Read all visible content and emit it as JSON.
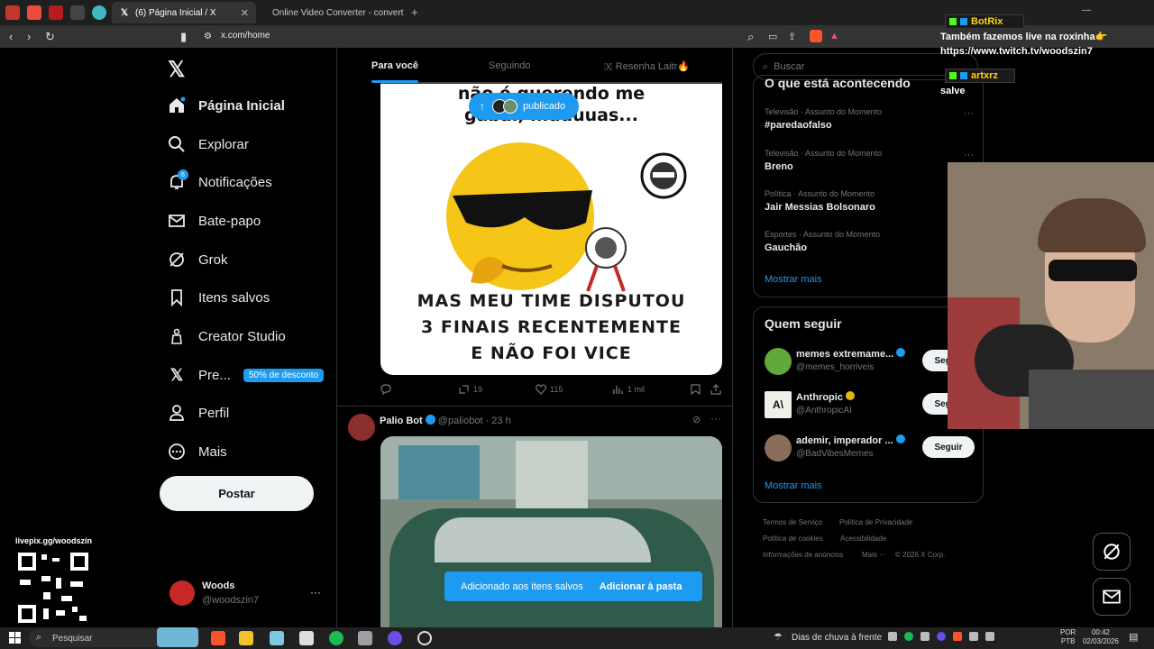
{
  "browser": {
    "tabs": [
      {
        "title": "(6) Página Inicial / X",
        "favicon": "x-logo",
        "active": true
      },
      {
        "title": "Online Video Converter - converta vi",
        "favicon": "converter-icon",
        "active": false
      }
    ],
    "new_tab": "+",
    "url": "x.com/home"
  },
  "nav": {
    "items": [
      {
        "label": "Página Inicial",
        "icon": "home-icon"
      },
      {
        "label": "Explorar",
        "icon": "search-icon"
      },
      {
        "label": "Notificações",
        "icon": "bell-icon",
        "badge": "6"
      },
      {
        "label": "Bate-papo",
        "icon": "mail-icon"
      },
      {
        "label": "Grok",
        "icon": "grok-icon"
      },
      {
        "label": "Itens salvos",
        "icon": "bookmark-icon"
      },
      {
        "label": "Creator Studio",
        "icon": "creator-icon"
      },
      {
        "label": "Pre...",
        "icon": "x-logo-icon",
        "badge": "50% de desconto"
      },
      {
        "label": "Perfil",
        "icon": "person-icon"
      },
      {
        "label": "Mais",
        "icon": "more-circle-icon"
      }
    ],
    "post_label": "Postar",
    "account": {
      "name": "Woods",
      "handle": "@woodszin7",
      "more": "···"
    }
  },
  "timeline": {
    "tabs": [
      "Para você",
      "Seguindo",
      "🇽 Resenha Laitr🔥"
    ],
    "new_posts_pill": "publicado",
    "meme": {
      "top_text_1": "não é querendo me",
      "top_text_2": "gabar, muuuuas...",
      "bottom_lines": [
        "MAS MEU TIME DISPUTOU",
        "3 FINAIS RECENTEMENTE",
        "E NÃO FOI VICE"
      ]
    },
    "post1_actions": {
      "reply": "",
      "retweets": "19",
      "likes": "115",
      "views": "1 mil"
    },
    "post2": {
      "name": "Palio Bot",
      "handle": "@paliobot",
      "time": "· 23 h"
    },
    "toast": {
      "text": "Adicionado aos itens salvos",
      "action": "Adicionar à pasta"
    }
  },
  "sidebar": {
    "search_placeholder": "Buscar",
    "trends_title": "O que está acontecendo",
    "trends": [
      {
        "category": "Televisão · Assunto do Momento",
        "name": "#paredaofalso"
      },
      {
        "category": "Televisão · Assunto do Momento",
        "name": "Breno"
      },
      {
        "category": "Política · Assunto do Momento",
        "name": "Jair Messias Bolsonaro"
      },
      {
        "category": "Esportes · Assunto do Momento",
        "name": "Gauchão"
      }
    ],
    "show_more": "Mostrar mais",
    "who_to_follow_title": "Quem seguir",
    "who_to_follow": [
      {
        "name": "memes extremame...",
        "handle": "@memes_horriveis",
        "button": "Seguir"
      },
      {
        "name": "Anthropic",
        "handle": "@AnthropicAI",
        "button": "Seguir"
      },
      {
        "name": "ademir, imperador ...",
        "handle": "@BadVibesMemes",
        "button": "Seguir"
      }
    ],
    "show_more_2": "Mostrar mais",
    "footer": [
      "Termos de Serviço",
      "Política de Privacidade",
      "Política de cookies",
      "Acessibilidade",
      "Informações de anúncios",
      "Mais ···",
      "© 2026 X Corp."
    ]
  },
  "overlay": {
    "chat": [
      {
        "user": "BotRix",
        "message": "Também fazemos live na roxinha👉 https://www.twitch.tv/woodszin7"
      },
      {
        "user": "artxrz",
        "message": "salve"
      }
    ],
    "livepix": "livepix.gg/woodszin"
  },
  "taskbar": {
    "search": "Pesquisar",
    "weather": "Dias de chuva à frente",
    "lang_1": "POR",
    "lang_2": "PTB",
    "time": "00:42",
    "date": "02/03/2026"
  },
  "colors": {
    "accent": "#1d9bf0",
    "background": "#000000",
    "border": "#2f3336",
    "muted": "#71767b"
  }
}
